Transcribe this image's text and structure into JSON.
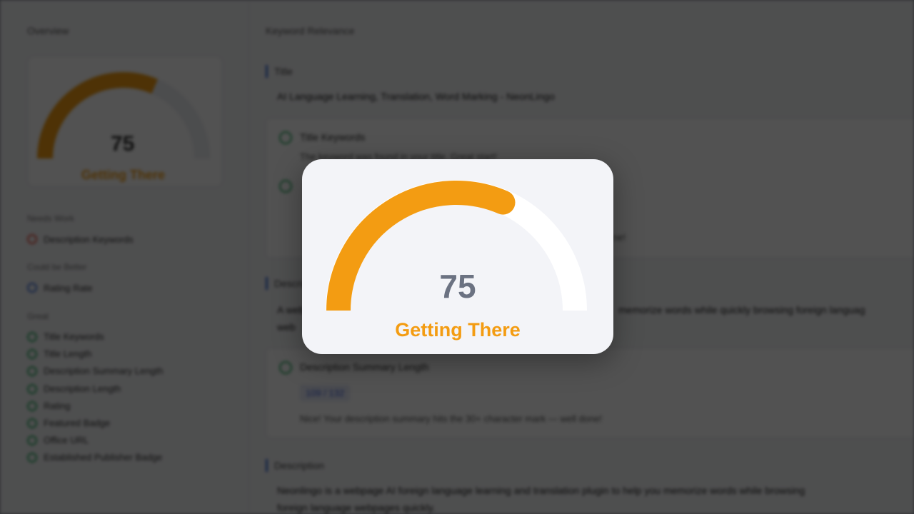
{
  "overview": {
    "title": "Overview",
    "score": "75",
    "status": "Getting There",
    "gauge_value_fraction": 0.75,
    "groups": [
      {
        "label": "Needs Work",
        "status": "red",
        "items": [
          "Description Keywords"
        ]
      },
      {
        "label": "Could be Better",
        "status": "blue",
        "items": [
          "Rating Rate"
        ]
      },
      {
        "label": "Great",
        "status": "green",
        "items": [
          "Title Keywords",
          "Title Length",
          "Description Summary Length",
          "Description Length",
          "Rating",
          "Featured Badge",
          "Office URL",
          "Established Publisher Badge"
        ]
      }
    ]
  },
  "main": {
    "title": "Keyword Relevance",
    "title_section": {
      "label": "Title",
      "value": "AI Language Learning, Translation, Word Marking - NeonLingo",
      "check_title": "Title Keywords",
      "check_desc": "The keyword was found in your title. Great start!",
      "trailing_text": "ne!"
    },
    "summary_section": {
      "label": "Description Summary",
      "value_start": "A web",
      "value_middle": "memorize words while quickly browsing foreign languag",
      "value_line2": "web",
      "check_title": "Description Summary Length",
      "counter": "109 / 132",
      "check_desc": "Nice! Your description summary hits the 30+ character mark — well done!"
    },
    "description_section": {
      "label": "Description",
      "line1": "Neonlingo is a webpage AI foreign language learning and translation plugin to help you memorize words while browsing",
      "line2": "foreign language webpages quickly."
    }
  },
  "modal": {
    "score": "75",
    "status": "Getting There",
    "gauge_value_fraction": 0.75
  },
  "colors": {
    "gauge_fill": "#f39c12",
    "gauge_track": "#ffffff",
    "score_text": "#6b7282",
    "status_text": "#f39c12",
    "good": "#27ae60",
    "bad": "#e74c3c",
    "neutral": "#3b6fd8"
  }
}
